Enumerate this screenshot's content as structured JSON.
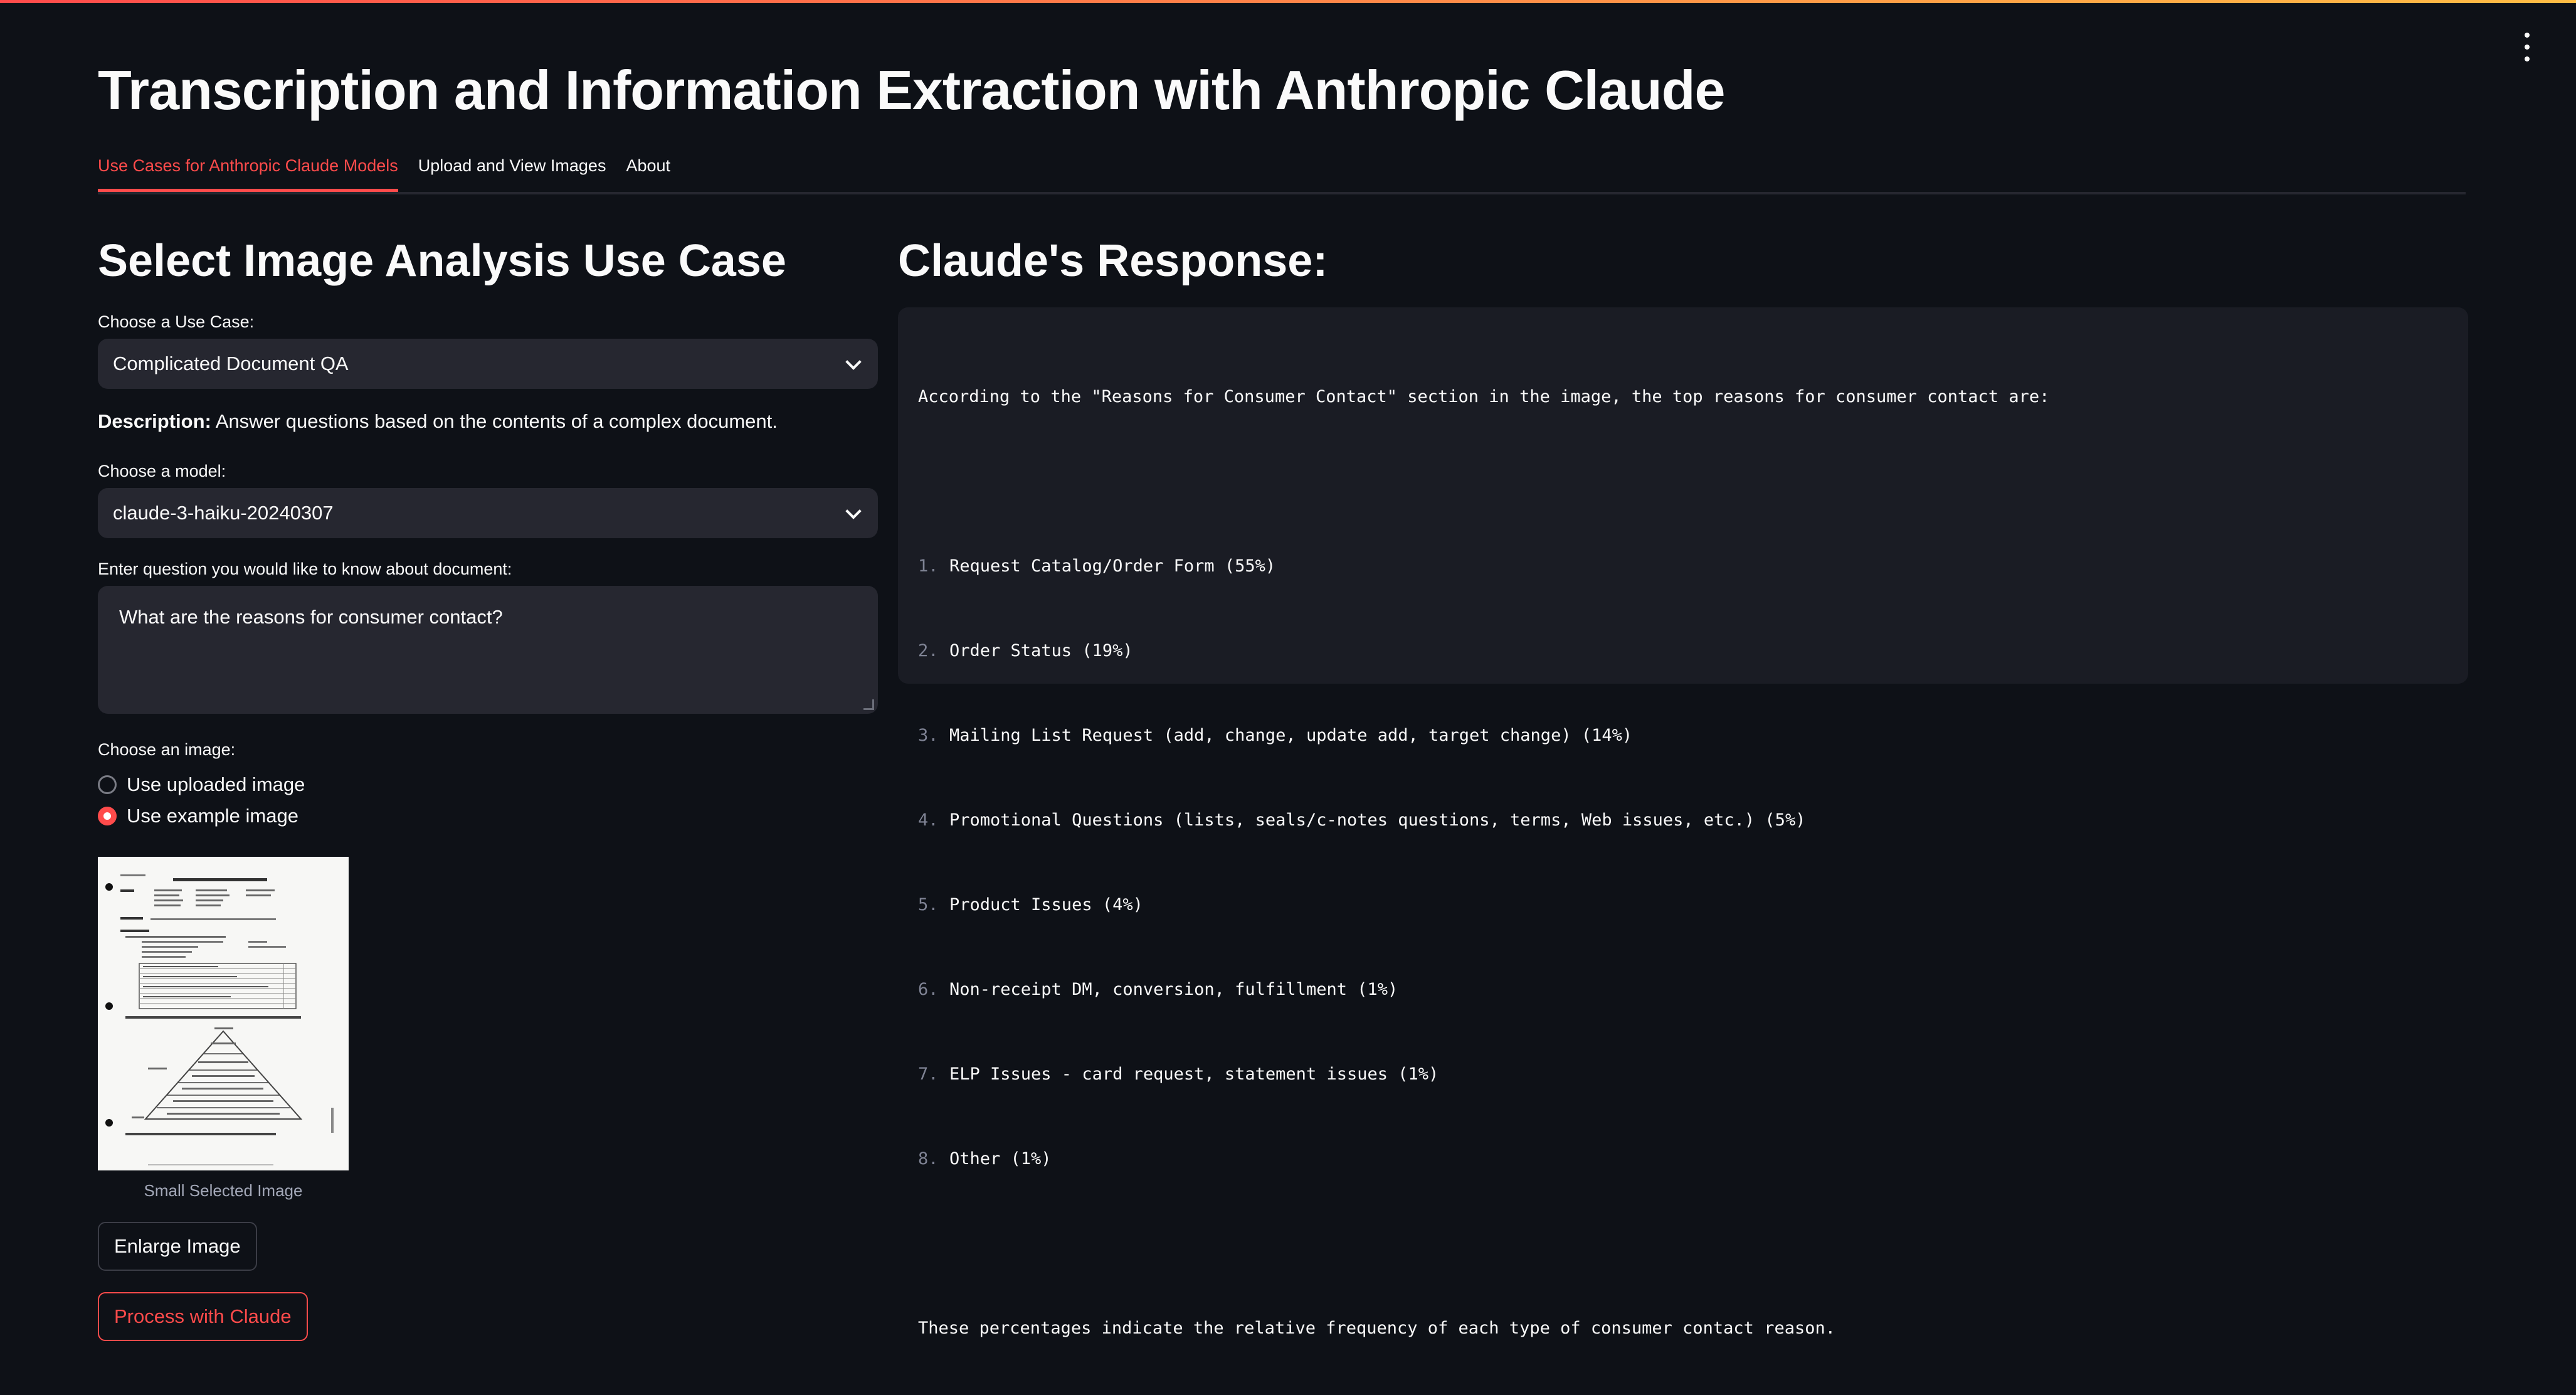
{
  "app": {
    "title": "Transcription and Information Extraction with Anthropic Claude"
  },
  "tabs": [
    {
      "label": "Use Cases for Anthropic Claude Models",
      "active": true
    },
    {
      "label": "Upload and View Images",
      "active": false
    },
    {
      "label": "About",
      "active": false
    }
  ],
  "left": {
    "heading": "Select Image Analysis Use Case",
    "use_case_label": "Choose a Use Case:",
    "use_case_value": "Complicated Document QA",
    "description_prefix": "Description:",
    "description_text": "Answer questions based on the contents of a complex document.",
    "model_label": "Choose a model:",
    "model_value": "claude-3-haiku-20240307",
    "question_label": "Enter question you would like to know about document:",
    "question_value": "What are the reasons for consumer contact?",
    "image_label": "Choose an image:",
    "radio_options": [
      {
        "label": "Use uploaded image",
        "checked": false
      },
      {
        "label": "Use example image",
        "checked": true
      }
    ],
    "thumbnail_caption": "Small Selected Image",
    "enlarge_button": "Enlarge Image",
    "process_button": "Process with Claude"
  },
  "right": {
    "heading": "Claude's Response:",
    "intro": "According to the \"Reasons for Consumer Contact\" section in the image, the top reasons for consumer contact are:",
    "items": [
      {
        "num": "1.",
        "text": "Request Catalog/Order Form (55%)"
      },
      {
        "num": "2.",
        "text": "Order Status (19%)"
      },
      {
        "num": "3.",
        "text": "Mailing List Request (add, change, update add, target change) (14%)"
      },
      {
        "num": "4.",
        "text": "Promotional Questions (lists, seals/c-notes questions, terms, Web issues, etc.) (5%)"
      },
      {
        "num": "5.",
        "text": "Product Issues (4%)"
      },
      {
        "num": "6.",
        "text": "Non-receipt DM, conversion, fulfillment (1%)"
      },
      {
        "num": "7.",
        "text": "ELP Issues - card request, statement issues (1%)"
      },
      {
        "num": "8.",
        "text": "Other (1%)"
      }
    ],
    "outro": "These percentages indicate the relative frequency of each type of consumer contact reason."
  },
  "colors": {
    "background": "#0e1117",
    "accent": "#ff4b4b",
    "widget_bg": "#262730",
    "code_bg": "#1a1c24"
  },
  "icons": [
    "more-vert-icon",
    "chevron-down-icon",
    "resize-grip-icon"
  ]
}
